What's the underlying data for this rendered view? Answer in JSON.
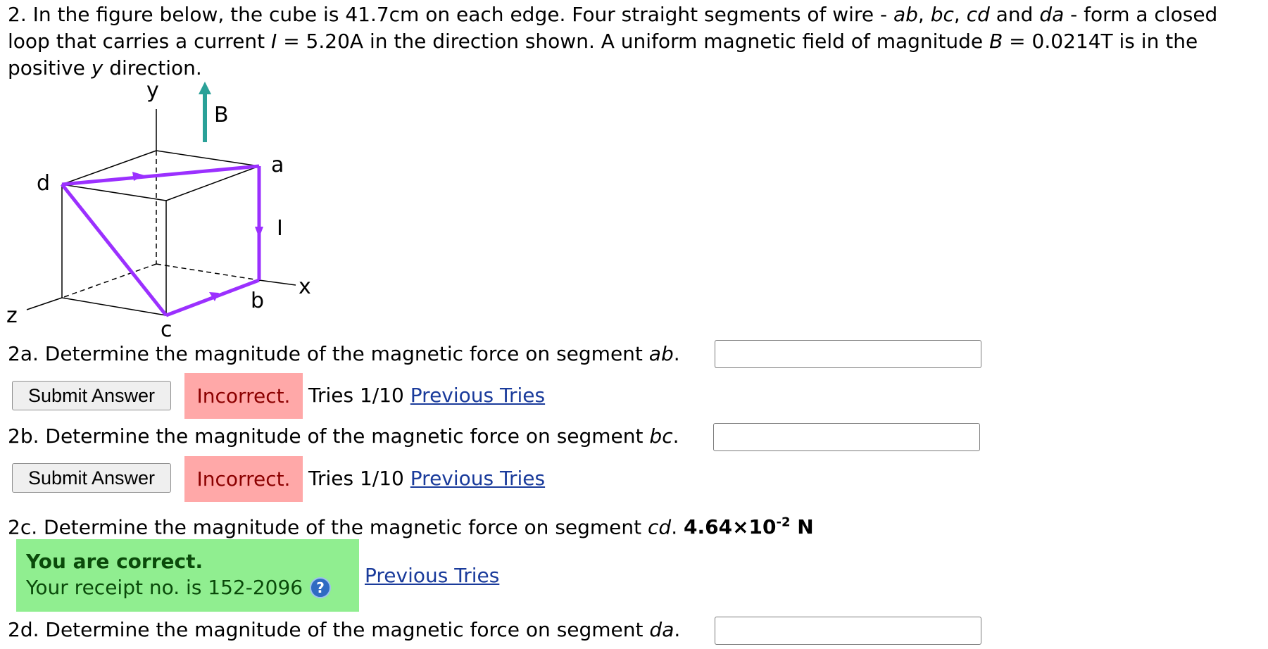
{
  "problem": {
    "intro_1": "2. In the figure below, the cube is 41.7cm on each edge. Four straight segments of wire - ",
    "seg_ab": "ab",
    "sep_1": ", ",
    "seg_bc": "bc",
    "sep_2": ", ",
    "seg_cd": "cd",
    "sep_3": " and ",
    "seg_da": "da",
    "intro_2": " - form a closed loop that carries a current ",
    "var_I": "I",
    "intro_3": " = 5.20A in the direction shown. A uniform magnetic field of magnitude ",
    "var_B": "B",
    "intro_4": " = 0.0214T is in the positive ",
    "var_y": "y",
    "intro_5": " direction."
  },
  "figure": {
    "label_y": "y",
    "label_B": "B",
    "label_a": "a",
    "label_d": "d",
    "label_I": "I",
    "label_b": "b",
    "label_x": "x",
    "label_z": "z",
    "label_c": "c",
    "wire_color": "#9b30ff",
    "field_arrow_color": "#2aa198"
  },
  "questions": {
    "q2a": {
      "text": "2a. Determine the magnitude of the magnetic force on segment ",
      "seg": "ab",
      "end": "."
    },
    "q2b": {
      "text": "2b. Determine the magnitude of the magnetic force on segment ",
      "seg": "bc",
      "end": "."
    },
    "q2c": {
      "text": "2c. Determine the magnitude of the magnetic force on segment ",
      "seg": "cd",
      "end": ".",
      "answer_mantissa": "4.64×10",
      "answer_exp": "-2",
      "answer_unit": " N"
    },
    "q2d": {
      "text": "2d. Determine the magnitude of the magnetic force on segment ",
      "seg": "da",
      "end": "."
    }
  },
  "feedback": {
    "submit_label": "Submit Answer",
    "incorrect_label": "Incorrect.",
    "tries_label": "Tries 1/10 ",
    "previous_tries_label": "Previous Tries",
    "correct_title": "You are correct.",
    "receipt_text": "Your receipt no. is 152-2096",
    "help_glyph": "?"
  }
}
